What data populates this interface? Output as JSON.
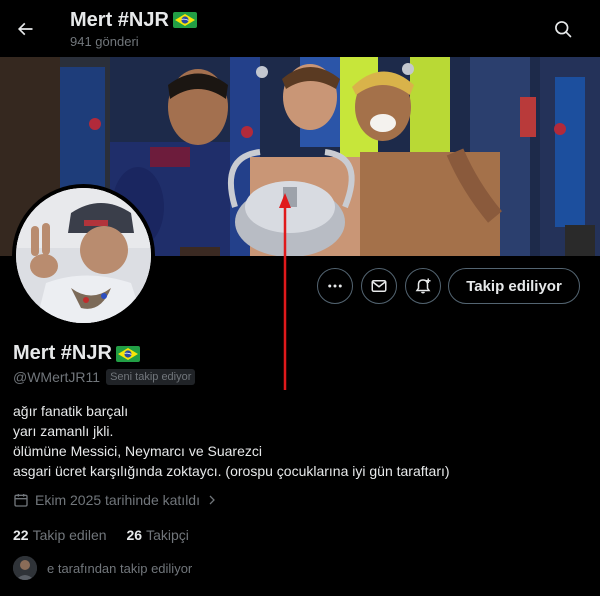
{
  "header": {
    "title": "Mert #NJR",
    "post_count": "941 gönderi",
    "back_icon": "arrow-left-icon",
    "search_icon": "search-icon"
  },
  "profile": {
    "name": "Mert #NJR",
    "handle": "@WMertJR11",
    "follows_you_badge": "Seni takip ediyor",
    "bio": [
      "ağır fanatik barçalı",
      "yarı zamanlı jkli.",
      "ölümüne Messici, Neymarcı ve Suarezci",
      "asgari ücret karşılığında zoktaycı. (orospu çocuklarına iyi gün taraftarı)"
    ],
    "joined": "Ekim 2025 tarihinde katıldı",
    "following_count": "22",
    "following_label": "Takip edilen",
    "followers_count": "26",
    "followers_label": "Takipçi",
    "followed_by": "e tarafından takip ediliyor"
  },
  "actions": {
    "more_icon": "more-horizontal-icon",
    "message_icon": "envelope-icon",
    "notify_icon": "bell-plus-icon",
    "follow_label": "Takip ediliyor"
  },
  "colors": {
    "background": "#000000",
    "text_primary": "#e7e9ea",
    "text_secondary": "#71767b",
    "border": "#536471",
    "annotation_arrow": "#e0191b"
  }
}
